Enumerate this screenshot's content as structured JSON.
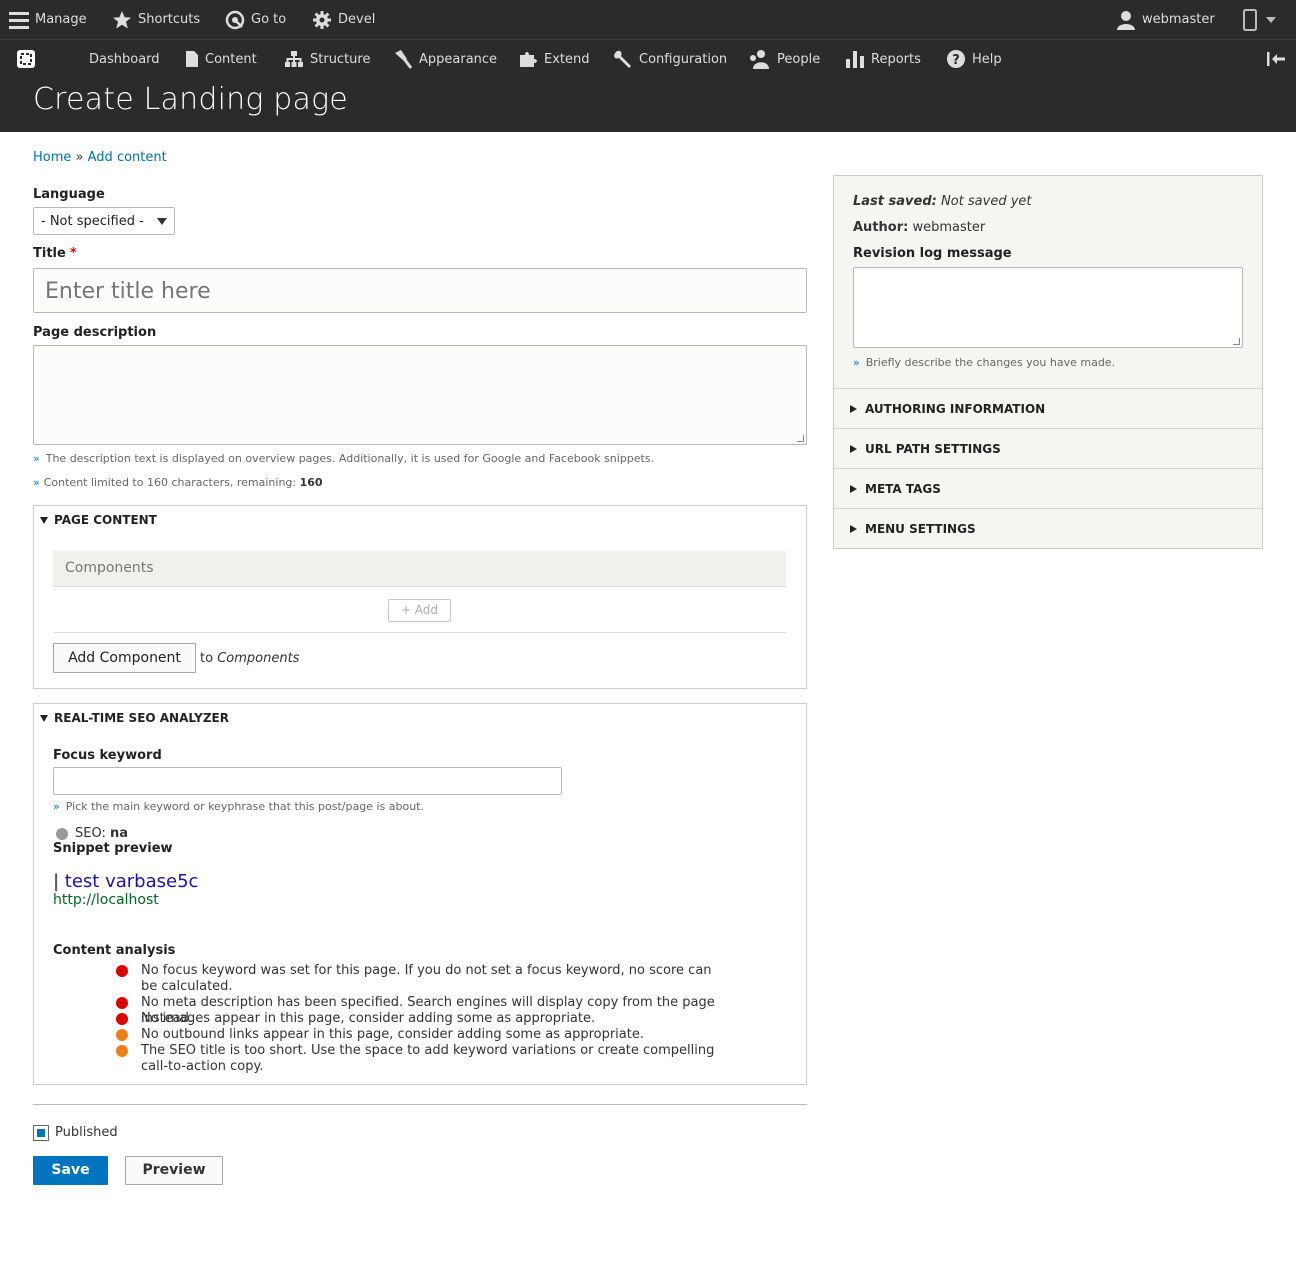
{
  "toolbar": {
    "manage": "Manage",
    "shortcuts": "Shortcuts",
    "goto": "Go to",
    "devel": "Devel",
    "user": "webmaster"
  },
  "tray": {
    "dashboard": "Dashboard",
    "content": "Content",
    "structure": "Structure",
    "appearance": "Appearance",
    "extend": "Extend",
    "configuration": "Configuration",
    "people": "People",
    "reports": "Reports",
    "help": "Help"
  },
  "page": {
    "title": "Create Landing page",
    "breadcrumb": {
      "home": "Home",
      "sep": "»",
      "add_content": "Add content"
    }
  },
  "form": {
    "language_label": "Language",
    "language_value": "- Not specified -",
    "title_label": "Title",
    "title_required": "*",
    "title_placeholder": "Enter title here",
    "description_label": "Page description",
    "description_help": "The description text is displayed on overview pages. Additionally, it is used for Google and Facebook snippets.",
    "char_limit_text": "Content limited to 160 characters, remaining: ",
    "char_limit_count": "160",
    "raquo": "»"
  },
  "page_content": {
    "legend": "PAGE CONTENT",
    "components_header": "Components",
    "add_small": "+ Add",
    "add_component_button": "Add Component",
    "to_text": "to",
    "to_target": "Components"
  },
  "seo": {
    "legend": "REAL-TIME SEO ANALYZER",
    "focus_label": "Focus keyword",
    "focus_value": "",
    "focus_help": "Pick the main keyword or keyphrase that this post/page is about.",
    "seo_label": "SEO:",
    "seo_value": "na",
    "snippet_label": "Snippet preview",
    "snippet_title": "| test varbase5c",
    "snippet_url": "http://localhost",
    "analysis_label": "Content analysis",
    "analysis": [
      {
        "text": "No focus keyword was set for this page. If you do not set a focus keyword, no score can be calculated.",
        "color": "#dc0000"
      },
      {
        "text": "No meta description has been specified. Search engines will display copy from the page instead.",
        "color": "#dc0000"
      },
      {
        "text": "No images appear in this page, consider adding some as appropriate.",
        "color": "#dc0000"
      },
      {
        "text": "No outbound links appear in this page, consider adding some as appropriate.",
        "color": "#ee7c1b"
      },
      {
        "text": "The SEO title is too short. Use the space to add keyword variations or create compelling call-to-action copy.",
        "color": "#ee7c1b"
      }
    ]
  },
  "sidebar": {
    "last_saved_label": "Last saved:",
    "last_saved_value": "Not saved yet",
    "author_label": "Author:",
    "author_value": "webmaster",
    "revision_label": "Revision log message",
    "revision_help": "Briefly describe the changes you have made.",
    "sections": [
      "AUTHORING INFORMATION",
      "URL PATH SETTINGS",
      "META TAGS",
      "MENU SETTINGS"
    ]
  },
  "actions": {
    "published_label": "Published",
    "published_checked": true,
    "save": "Save",
    "preview": "Preview"
  },
  "colors": {
    "toolbar_bg": "#2b2b2b",
    "link": "#0071b8",
    "primary": "#0074bd",
    "snippet_title": "#1e0fbe",
    "snippet_url": "#006621"
  }
}
